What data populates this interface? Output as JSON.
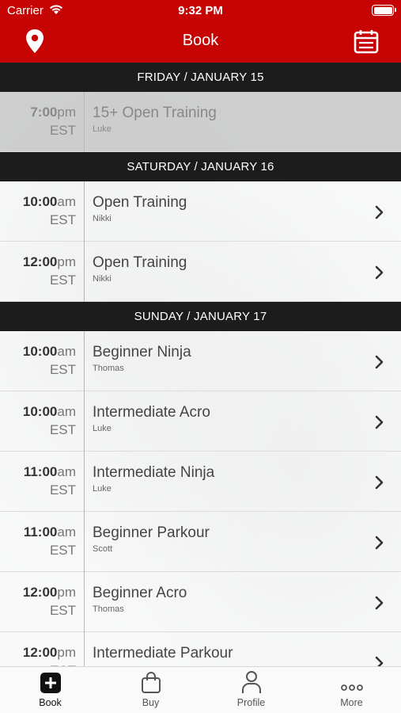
{
  "status": {
    "carrier": "Carrier",
    "time": "9:32 PM"
  },
  "nav": {
    "title": "Book"
  },
  "days": [
    {
      "label": "FRIDAY / JANUARY 15",
      "rows": [
        {
          "hour": "7:00",
          "ampm": "pm",
          "tz": "EST",
          "name": "15+ Open Training",
          "instructor": "Luke",
          "past": true
        }
      ]
    },
    {
      "label": "SATURDAY / JANUARY 16",
      "rows": [
        {
          "hour": "10:00",
          "ampm": "am",
          "tz": "EST",
          "name": "Open Training",
          "instructor": "Nikki",
          "past": false
        },
        {
          "hour": "12:00",
          "ampm": "pm",
          "tz": "EST",
          "name": "Open Training",
          "instructor": "Nikki",
          "past": false
        }
      ]
    },
    {
      "label": "SUNDAY / JANUARY 17",
      "rows": [
        {
          "hour": "10:00",
          "ampm": "am",
          "tz": "EST",
          "name": "Beginner Ninja",
          "instructor": "Thomas",
          "past": false
        },
        {
          "hour": "10:00",
          "ampm": "am",
          "tz": "EST",
          "name": "Intermediate Acro",
          "instructor": "Luke",
          "past": false
        },
        {
          "hour": "11:00",
          "ampm": "am",
          "tz": "EST",
          "name": "Intermediate Ninja",
          "instructor": "Luke",
          "past": false
        },
        {
          "hour": "11:00",
          "ampm": "am",
          "tz": "EST",
          "name": "Beginner Parkour",
          "instructor": "Scott",
          "past": false
        },
        {
          "hour": "12:00",
          "ampm": "pm",
          "tz": "EST",
          "name": "Beginner Acro",
          "instructor": "Thomas",
          "past": false
        },
        {
          "hour": "12:00",
          "ampm": "pm",
          "tz": "EST",
          "name": "Intermediate Parkour",
          "instructor": "",
          "past": false
        }
      ]
    }
  ],
  "tabs": [
    {
      "label": "Book",
      "icon": "plus-square-icon",
      "active": true
    },
    {
      "label": "Buy",
      "icon": "shopping-bag-icon",
      "active": false
    },
    {
      "label": "Profile",
      "icon": "person-icon",
      "active": false
    },
    {
      "label": "More",
      "icon": "more-dots-icon",
      "active": false
    }
  ],
  "colors": {
    "brand": "#c70404",
    "header": "#1c1c1c"
  }
}
